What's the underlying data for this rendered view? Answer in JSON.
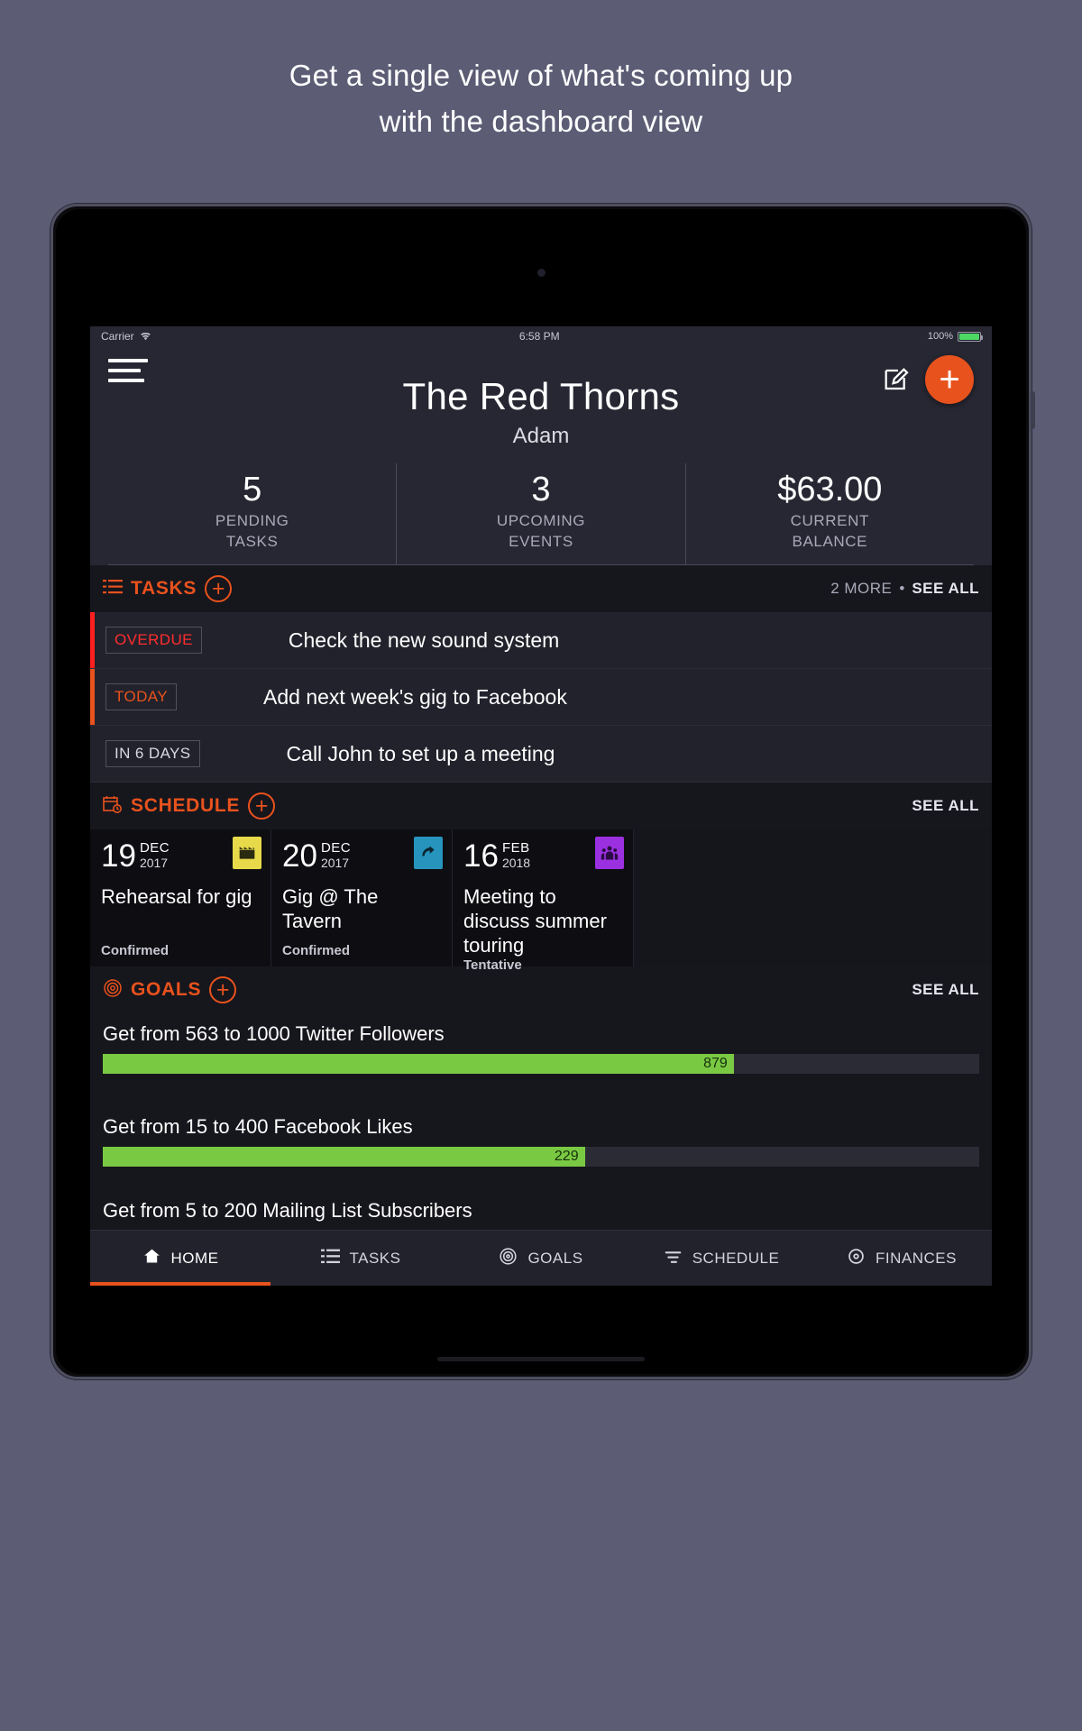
{
  "promo": {
    "line1": "Get a single view of what's coming up",
    "line2": "with the dashboard view"
  },
  "statusbar": {
    "carrier": "Carrier",
    "wifi_icon": "wifi-icon",
    "time": "6:58 PM",
    "battery_percent": "100%",
    "battery_icon": "battery-full-icon"
  },
  "header": {
    "menu_icon": "hamburger-menu-icon",
    "edit_icon": "edit-pencil-icon",
    "add_icon": "plus-icon",
    "band_name": "The Red Thorns",
    "user_name": "Adam"
  },
  "stats": [
    {
      "value": "5",
      "line1": "PENDING",
      "line2": "TASKS"
    },
    {
      "value": "3",
      "line1": "UPCOMING",
      "line2": "EVENTS"
    },
    {
      "value": "$63.00",
      "line1": "CURRENT",
      "line2": "BALANCE"
    }
  ],
  "tasks_section": {
    "icon": "list-icon",
    "title": "TASKS",
    "add_label": "+",
    "more_count": "2 MORE",
    "separator": "•",
    "see_all": "SEE ALL",
    "items": [
      {
        "badge": "OVERDUE",
        "title": "Check the new sound system",
        "badge_color": "#ff2d2d",
        "stripe_color": "#ff1f1f"
      },
      {
        "badge": "TODAY",
        "title": "Add next week's gig to Facebook",
        "badge_color": "#e8521d",
        "stripe_color": "#e8521d"
      },
      {
        "badge": "IN 6 DAYS",
        "title": "Call John to set up a meeting",
        "badge_color": "#d8d8e2",
        "stripe_color": "transparent"
      }
    ]
  },
  "schedule_section": {
    "icon": "calendar-clock-icon",
    "title": "SCHEDULE",
    "add_label": "+",
    "see_all": "SEE ALL",
    "cards": [
      {
        "day": "19",
        "month": "DEC",
        "year": "2017",
        "name": "Rehearsal for gig",
        "status": "Confirmed",
        "tag_color": "#e8d94a",
        "tag_icon": "clapperboard-icon"
      },
      {
        "day": "20",
        "month": "DEC",
        "year": "2017",
        "name": "Gig @ The Tavern",
        "status": "Confirmed",
        "tag_color": "#2694bd",
        "tag_icon": "concert-icon"
      },
      {
        "day": "16",
        "month": "FEB",
        "year": "2018",
        "name": "Meeting to discuss summer touring",
        "status": "Tentative",
        "tag_color": "#9b30e0",
        "tag_icon": "people-icon"
      }
    ]
  },
  "goals_section": {
    "icon": "target-icon",
    "title": "GOALS",
    "add_label": "+",
    "see_all": "SEE ALL",
    "items": [
      {
        "title": "Get from 563 to 1000 Twitter Followers",
        "value": "879",
        "percent": 72
      },
      {
        "title": "Get from 15 to 400 Facebook Likes",
        "value": "229",
        "percent": 55
      }
    ],
    "cut_off_title": "Get from 5 to 200 Mailing List Subscribers"
  },
  "tabbar": [
    {
      "label": "HOME",
      "icon": "home-icon",
      "active": true
    },
    {
      "label": "TASKS",
      "icon": "list-icon",
      "active": false
    },
    {
      "label": "GOALS",
      "icon": "target-icon",
      "active": false
    },
    {
      "label": "SCHEDULE",
      "icon": "sliders-icon",
      "active": false
    },
    {
      "label": "FINANCES",
      "icon": "coin-icon",
      "active": false
    }
  ],
  "colors": {
    "accent": "#e8521d",
    "overdue": "#ff2d2d",
    "progress": "#7ac943",
    "page_bg": "#5c5c75",
    "screen_bg": "#16161d"
  },
  "chart_data": {
    "type": "bar",
    "title": "Goals progress",
    "orientation": "horizontal",
    "categories": [
      "Get from 563 to 1000 Twitter Followers",
      "Get from 15 to 400 Facebook Likes"
    ],
    "values": [
      879,
      229
    ],
    "targets": [
      1000,
      400
    ],
    "starts": [
      563,
      15
    ],
    "percents": [
      72,
      55
    ],
    "bar_color": "#7ac943",
    "track_color": "#2b2b36",
    "xlabel": "",
    "ylabel": "",
    "grid": false,
    "legend": "none"
  }
}
